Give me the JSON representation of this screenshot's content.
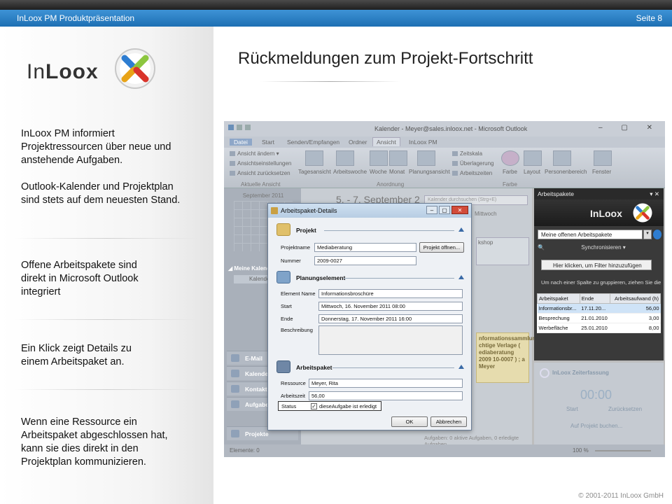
{
  "header": {
    "presentation_title": "InLoox PM Produktpräsentation",
    "page_label": "Seite 8"
  },
  "logo": {
    "text_in": "In",
    "text_loox": "Loox"
  },
  "left": {
    "p1": "InLoox PM informiert Projektressourcen über neue und anstehende Aufgaben.",
    "p2": "Outlook-Kalender und Projektplan sind stets auf dem neuesten Stand.",
    "p3": "Offene Arbeitspakete sind direkt in Microsoft Outlook integriert",
    "p4": "Ein Klick zeigt Details zu einem Arbeitspaket an.",
    "p5": "Wenn eine Ressource ein Arbeitspaket abgeschlossen hat, kann sie dies direkt in den Projektplan kommunizieren."
  },
  "slide_title": "Rückmeldungen zum Projekt-Fortschritt",
  "outlook": {
    "window_title": "Kalender - Meyer@sales.inloox.net - Microsoft Outlook",
    "tabs": [
      "Datei",
      "Start",
      "Senden/Empfangen",
      "Ordner",
      "Ansicht",
      "InLoox PM"
    ],
    "active_tab": "Ansicht",
    "ribbon": {
      "view_change": "Ansicht ändern",
      "view_settings": "Ansichtseinstellungen",
      "view_reset": "Ansicht zurücksetzen",
      "group_current": "Aktuelle Ansicht",
      "day": "Tagesansicht",
      "workweek": "Arbeitswoche",
      "week": "Woche",
      "month": "Monat",
      "plan": "Planungsansicht",
      "timescale": "Zeitskala",
      "overlay": "Überlagerung",
      "worktime": "Arbeitszeiten",
      "group_arrangement": "Anordnung",
      "color": "Farbe",
      "group_color": "Farbe",
      "layout": "Layout",
      "persons": "Personenbereich",
      "window": "Fenster"
    },
    "mini_cal_month": "September 2011",
    "my_cal": "Meine Kalender",
    "cal_item": "Kalender",
    "date_range": "5. - 7. September 2",
    "search_placeholder": "Kalender durchsuchen (Strg+E)",
    "day_label": "Mittwoch",
    "workshop": "kshop",
    "appt_text": "nformationssammlun chtige Verlage ( ediaberatung 2009 10-0007 ) ; a Meyer",
    "nav": [
      "E-Mail",
      "Kalender",
      "Kontakte",
      "Aufgaben",
      "Projekte"
    ],
    "status_left": "Elemente: 0",
    "status_tasks": "Aufgaben: 0 aktive Aufgaben, 0 erledigte Aufgaben",
    "zoom": "100 %"
  },
  "pane": {
    "title": "Arbeitspakete",
    "logo_text": "InLoox",
    "select_value": "Meine offenen Arbeitspakete",
    "sync": "Synchronisieren",
    "filter": "Hier klicken, um Filter hinzuzufügen",
    "group_hint": "Um nach einer Spalte zu gruppieren, ziehen Sie die",
    "columns": [
      "Arbeitspaket",
      "Ende",
      "Arbeitsaufwand (h)"
    ],
    "rows": [
      [
        "Informationsbr...",
        "17.11.20...",
        "56,00"
      ],
      [
        "Besprechung",
        "21.01.2010",
        "3,00"
      ],
      [
        "Werbefläche",
        "25.01.2010",
        "8,00"
      ]
    ],
    "time_title": "InLoox Zeiterfassung",
    "time_value": "00:00",
    "start": "Start",
    "reset": "Zurücksetzen",
    "book": "Auf Projekt buchen..."
  },
  "dialog": {
    "title": "Arbeitspaket-Details",
    "sec_project": "Projekt",
    "lbl_projectname": "Projektname",
    "val_projectname": "Mediaberatung",
    "btn_open": "Projekt öffnen...",
    "lbl_number": "Nummer",
    "val_number": "2009-0027",
    "sec_plan": "Planungselement",
    "lbl_element": "Element Name",
    "val_element": "Informationsbroschüre",
    "lbl_start": "Start",
    "val_start": "Mittwoch, 16. November 2011 08:00",
    "lbl_end": "Ende",
    "val_end": "Donnerstag, 17. November 2011 16:00",
    "lbl_desc": "Beschreibung",
    "sec_wp": "Arbeitspaket",
    "lbl_resource": "Ressource",
    "val_resource": "Meyer, Rita",
    "lbl_worktime": "Arbeitszeit",
    "val_worktime": "56,00",
    "lbl_status": "Status",
    "status_check": "dieseAufgabe ist erledigt",
    "ok": "OK",
    "cancel": "Abbrechen"
  },
  "footer": "© 2001-2011 InLoox GmbH"
}
